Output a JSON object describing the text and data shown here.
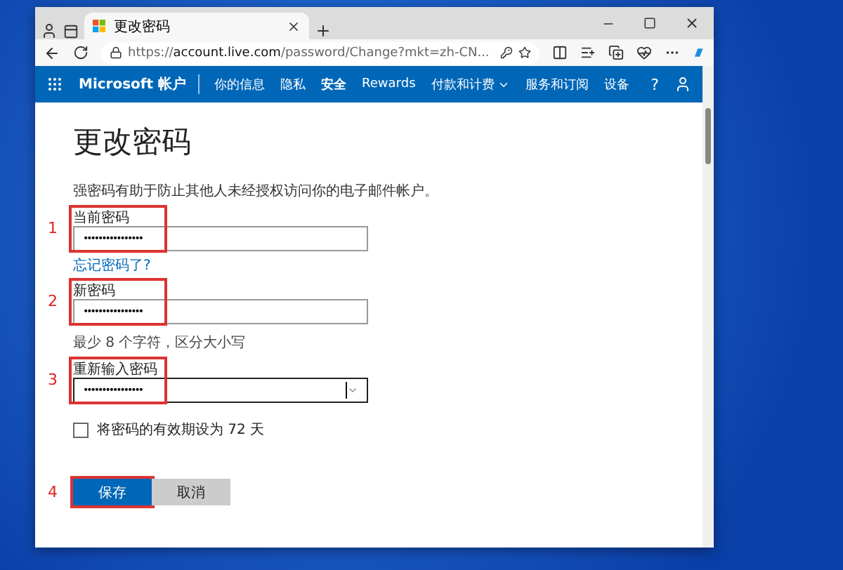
{
  "browser": {
    "tab_title": "更改密码",
    "url_prefix": "https://",
    "url_host": "account.live.com",
    "url_path": "/password/Change?mkt=zh-CN..."
  },
  "nav": {
    "brand": "Microsoft 帐户",
    "items": [
      {
        "label": "你的信息",
        "selected": false,
        "kind": "link"
      },
      {
        "label": "隐私",
        "selected": false,
        "kind": "link"
      },
      {
        "label": "安全",
        "selected": true,
        "kind": "link"
      },
      {
        "label": "Rewards",
        "selected": false,
        "kind": "link"
      },
      {
        "label": "付款和计费",
        "selected": false,
        "kind": "menu"
      },
      {
        "label": "服务和订阅",
        "selected": false,
        "kind": "link"
      },
      {
        "label": "设备",
        "selected": false,
        "kind": "link"
      }
    ],
    "help": "?"
  },
  "page": {
    "title": "更改密码",
    "description": "强密码有助于防止其他人未经授权访问你的电子邮件帐户。",
    "fields": [
      {
        "label": "当前密码",
        "value": "••••••••••••••••",
        "step": "1",
        "focused": false,
        "after": {
          "kind": "link",
          "text": "忘记密码了?"
        }
      },
      {
        "label": "新密码",
        "value": "••••••••••••••••",
        "step": "2",
        "focused": false,
        "after": {
          "kind": "hint",
          "text": "最少 8 个字符，区分大小写"
        }
      },
      {
        "label": "重新输入密码",
        "value": "••••••••••••••••",
        "step": "3",
        "focused": true
      }
    ],
    "checkbox": {
      "label": "将密码的有效期设为 72 天",
      "checked": false
    },
    "buttons": [
      {
        "label": "保存",
        "kind": "primary",
        "step": "4"
      },
      {
        "label": "取消",
        "kind": "secondary"
      }
    ]
  }
}
